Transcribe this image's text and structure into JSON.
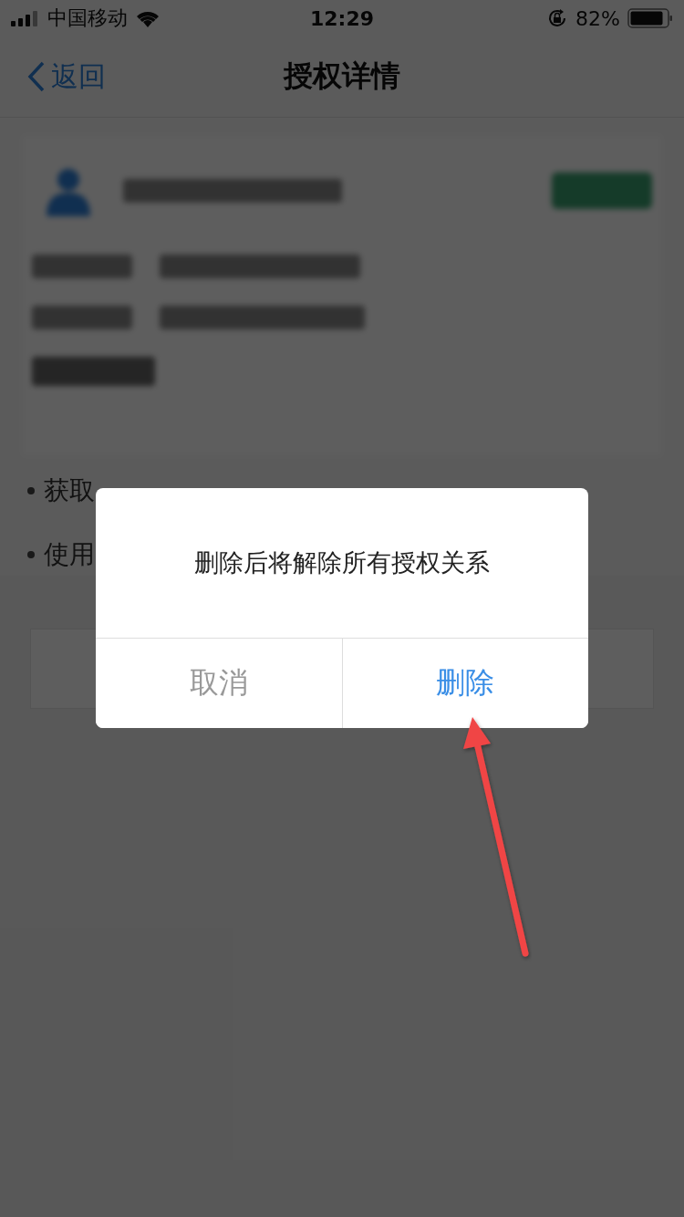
{
  "status_bar": {
    "carrier": "中国移动",
    "time": "12:29",
    "battery": "82%"
  },
  "nav": {
    "back": "返回",
    "title": "授权详情"
  },
  "list_items": [
    {
      "text": "获取"
    },
    {
      "text": "使用"
    }
  ],
  "dialog": {
    "message": "删除后将解除所有授权关系",
    "buttons": [
      {
        "label": "取消",
        "kind": "cancel"
      },
      {
        "label": "删除",
        "kind": "confirm"
      }
    ]
  }
}
